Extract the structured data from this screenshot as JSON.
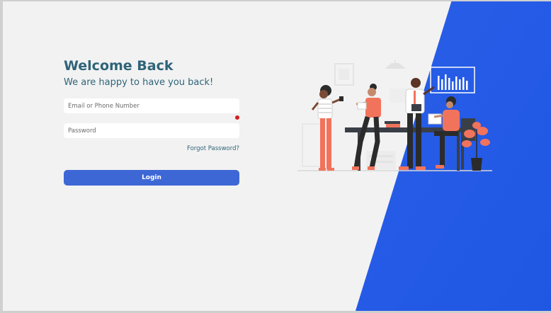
{
  "login": {
    "title": "Welcome Back",
    "subtitle": "We are happy to have you back!",
    "email_placeholder": "Email or Phone Number",
    "password_placeholder": "Password",
    "forgot_label": "Forgot Password?",
    "login_label": "Login"
  },
  "colors": {
    "accent_blue": "#2457e6",
    "heading": "#2f6478",
    "button": "#3e67d6",
    "figure_coral": "#f2735c",
    "error_dot": "#d42020"
  },
  "illustration": {
    "subject": "team-meeting-illustration"
  }
}
